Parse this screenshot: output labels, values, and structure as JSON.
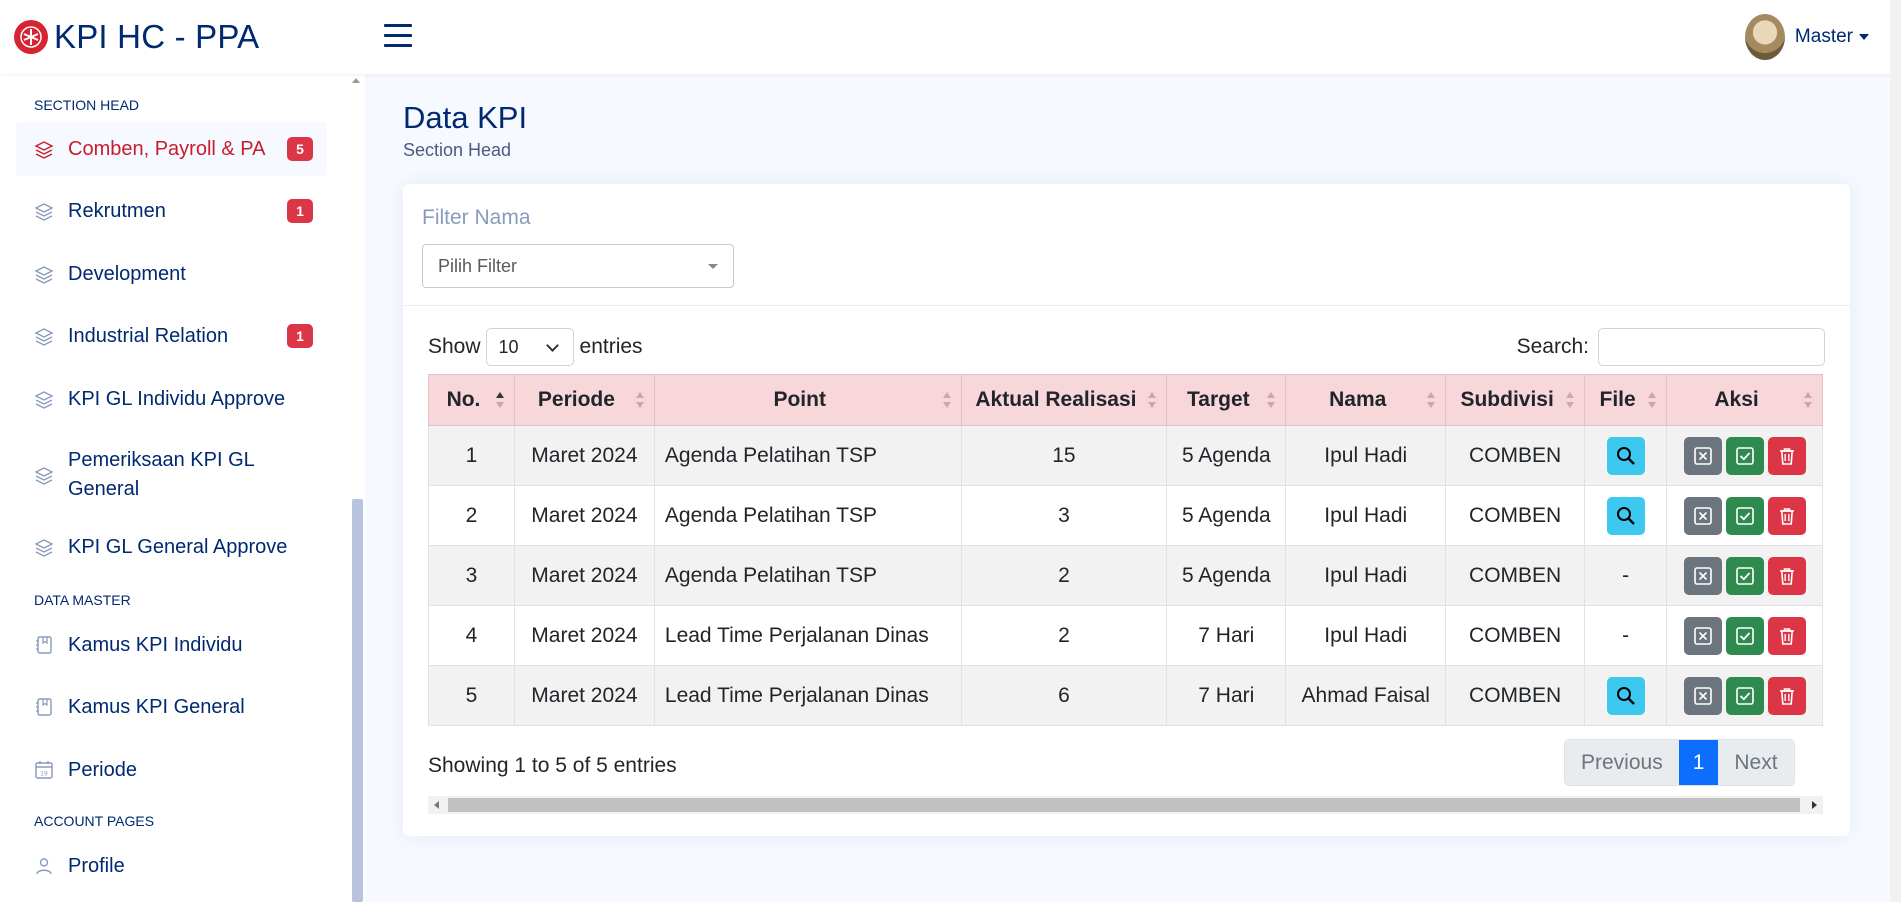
{
  "app": {
    "brand": "KPI HC - PPA",
    "user": "Master"
  },
  "colors": {
    "brand_red": "#d62430",
    "navy": "#012970",
    "header_row": "#f8d7da",
    "view": "#3dc8f0",
    "primary": "#0d6efd"
  },
  "sidebar": {
    "heading_1": "SECTION HEAD",
    "items_1": [
      {
        "label": "Comben, Payroll & PA",
        "badge": "5",
        "icon": "layers-icon"
      },
      {
        "label": "Rekrutmen",
        "badge": "1",
        "icon": "layers-icon"
      },
      {
        "label": "Development",
        "icon": "layers-icon"
      },
      {
        "label": "Industrial Relation",
        "badge": "1",
        "icon": "layers-icon"
      },
      {
        "label": "KPI GL Individu Approve",
        "icon": "layers-icon"
      },
      {
        "label": "Pemeriksaan KPI GL General",
        "icon": "layers-icon"
      },
      {
        "label": "KPI GL General Approve",
        "icon": "layers-icon"
      }
    ],
    "heading_2": "DATA MASTER",
    "items_2": [
      {
        "label": "Kamus KPI Individu",
        "icon": "journal-icon"
      },
      {
        "label": "Kamus KPI General",
        "icon": "journal-icon"
      },
      {
        "label": "Periode",
        "icon": "calendar-icon"
      }
    ],
    "heading_3": "ACCOUNT PAGES",
    "items_3": [
      {
        "label": "Profile",
        "icon": "person-icon"
      }
    ]
  },
  "page": {
    "title": "Data KPI",
    "subtitle": "Section Head",
    "filter_label": "Filter Nama",
    "filter_placeholder": "Pilih Filter",
    "show": "Show",
    "length_value": "10",
    "entries": "entries",
    "search_label": "Search:",
    "info": "Showing 1 to 5 of 5 entries",
    "pager": {
      "prev": "Previous",
      "current": "1",
      "next": "Next"
    }
  },
  "table": {
    "columns": [
      "No.",
      "Periode",
      "Point",
      "Aktual Realisasi",
      "Target",
      "Nama",
      "Subdivisi",
      "File",
      "Aksi"
    ],
    "rows": [
      {
        "no": "1",
        "periode": "Maret 2024",
        "point": "Agenda Pelatihan TSP",
        "aktual": "15",
        "target": "5 Agenda",
        "nama": "Ipul Hadi",
        "subdivisi": "COMBEN",
        "file": "view"
      },
      {
        "no": "2",
        "periode": "Maret 2024",
        "point": "Agenda Pelatihan TSP",
        "aktual": "3",
        "target": "5 Agenda",
        "nama": "Ipul Hadi",
        "subdivisi": "COMBEN",
        "file": "view"
      },
      {
        "no": "3",
        "periode": "Maret 2024",
        "point": "Agenda Pelatihan TSP",
        "aktual": "2",
        "target": "5 Agenda",
        "nama": "Ipul Hadi",
        "subdivisi": "COMBEN",
        "file": "-"
      },
      {
        "no": "4",
        "periode": "Maret 2024",
        "point": "Lead Time Perjalanan Dinas",
        "aktual": "2",
        "target": "7 Hari",
        "nama": "Ipul Hadi",
        "subdivisi": "COMBEN",
        "file": "-"
      },
      {
        "no": "5",
        "periode": "Maret 2024",
        "point": "Lead Time Perjalanan Dinas",
        "aktual": "6",
        "target": "7 Hari",
        "nama": "Ahmad Faisal",
        "subdivisi": "COMBEN",
        "file": "view"
      }
    ]
  }
}
